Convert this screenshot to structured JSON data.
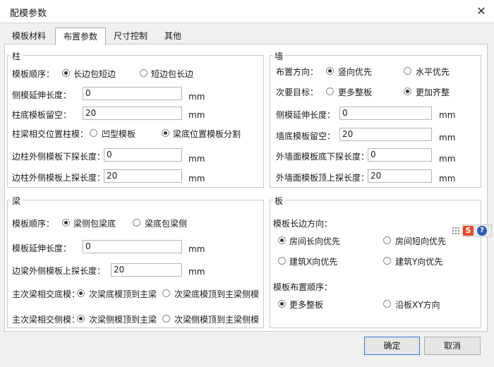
{
  "window": {
    "title": "配模参数",
    "close": "✕"
  },
  "tabs": [
    "模板材料",
    "布置参数",
    "尺寸控制",
    "其他"
  ],
  "column": {
    "title": "柱",
    "order_label": "模板顺序：",
    "order_opt1": "长边包短边",
    "order_opt2": "短边包长边",
    "side_ext_label": "侧模延伸长度：",
    "side_ext_value": "0",
    "base_reserve_label": "柱底模板留空：",
    "base_reserve_value": "20",
    "joint_label": "柱梁相交位置柱模：",
    "joint_opt1": "凹型模板",
    "joint_opt2": "梁底位置模板分割",
    "edge_down_label": "边柱外侧模板下探长度：",
    "edge_down_value": "0",
    "edge_up_label": "边柱外侧模板上探长度：",
    "edge_up_value": "20",
    "unit": "mm"
  },
  "wall": {
    "title": "墙",
    "dir_label": "布置方向：",
    "dir_opt1": "竖向优先",
    "dir_opt2": "水平优先",
    "goal_label": "次要目标：",
    "goal_opt1": "更多整板",
    "goal_opt2": "更加齐整",
    "side_ext_label": "侧模延伸长度：",
    "side_ext_value": "0",
    "base_reserve_label": "墙底模板留空：",
    "base_reserve_value": "20",
    "ext_down_label": "外墙面模板底下探长度：",
    "ext_down_value": "0",
    "ext_up_label": "外墙面模板顶上探长度：",
    "ext_up_value": "20",
    "unit": "mm"
  },
  "beam": {
    "title": "梁",
    "order_label": "模板顺序：",
    "order_opt1": "梁侧包梁底",
    "order_opt2": "梁底包梁侧",
    "ext_label": "模板延伸长度：",
    "ext_value": "0",
    "edge_up_label": "边梁外侧模板上探长度：",
    "edge_up_value": "20",
    "bottom_label": "主次梁相交底模：",
    "bottom_opt1": "次梁底模顶到主梁",
    "bottom_opt2": "次梁底模顶到主梁侧模",
    "side_label": "主次梁相交侧模：",
    "side_opt1": "次梁侧模顶到主梁",
    "side_opt2": "次梁侧模顶到主梁侧模",
    "unit": "mm"
  },
  "slab": {
    "title": "板",
    "long_dir_label": "模板长边方向：",
    "opt_room_long": "房间长向优先",
    "opt_room_short": "房间短向优先",
    "opt_bldg_x": "建筑X向优先",
    "opt_bldg_y": "建筑Y向优先",
    "layout_order_label": "模板布置顺序：",
    "opt_more_full": "更多整板",
    "opt_along_xy": "沿板XY方向"
  },
  "buttons": {
    "ok": "确定",
    "cancel": "取消"
  },
  "ime": {
    "s": "S",
    "help": "?"
  }
}
